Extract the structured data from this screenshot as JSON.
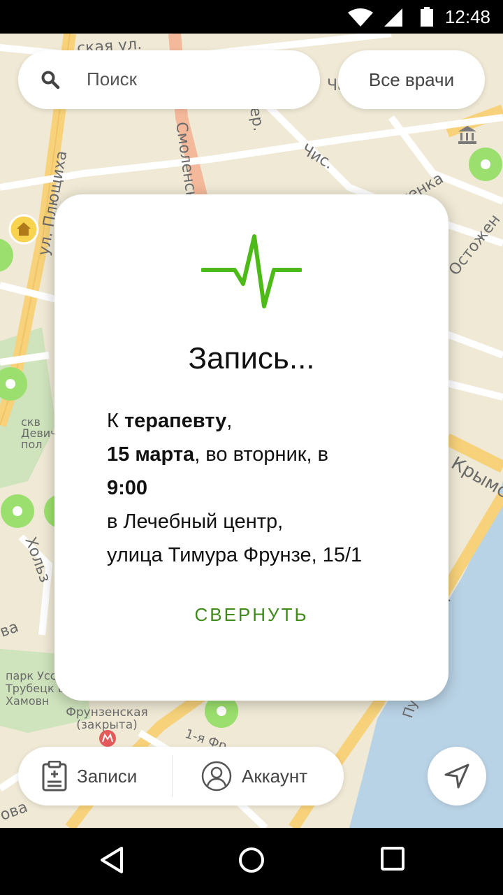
{
  "status_bar": {
    "time": "12:48"
  },
  "search": {
    "placeholder": "Поиск",
    "all_doctors_label": "Все врачи"
  },
  "map_labels": {
    "street_1": "ская ул.",
    "street_2": "Смоленск",
    "street_3": "ул. Плющиха",
    "street_4": "Ча",
    "street_5": "Чис.",
    "street_6": "ер.",
    "street_7": "тенка",
    "street_8": "Остожен",
    "street_9": "Крымс",
    "street_10": "Пушкинская наб.",
    "street_11": "Хольз",
    "park_1": "скв Девич пол",
    "park_2": "парк Усс Трубецк в Хамовн",
    "metro": "Фрунзенская (закрыта)",
    "street_12": "1-я Фр",
    "street_13": "ва",
    "street_14": "ова"
  },
  "dialog": {
    "title": "Запись...",
    "line1_prefix": "К ",
    "line1_bold": "терапевту",
    "line1_suffix": ",",
    "line2_bold": "15 марта",
    "line2_suffix": ", во вторник, в",
    "line3_bold": "9:00",
    "line4": "в Лечебный центр,",
    "line5": "улица Тимура Фрунзе, 15/1",
    "collapse_label": "СВЕРНУТЬ",
    "accent_color": "#3f8a1a",
    "icon": "pulse-icon"
  },
  "bottom_nav": {
    "records_label": "Записи",
    "account_label": "Аккаунт"
  }
}
